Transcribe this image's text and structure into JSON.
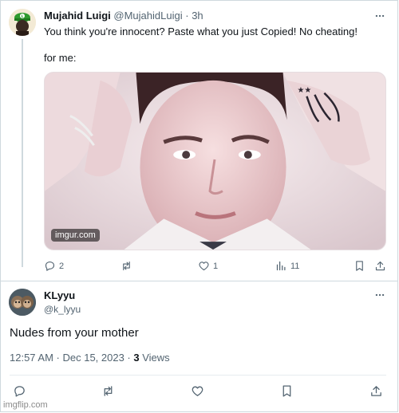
{
  "tweet": {
    "author_name": "Mujahid Luigi",
    "author_handle": "@MujahidLuigi",
    "separator": "·",
    "time": "3h",
    "text_line1": "You think you're innocent? Paste what you just Copied! No cheating!",
    "text_line2": "for me:",
    "image_caption": "imgur.com",
    "actions": {
      "replies": "2",
      "reposts": "",
      "likes": "1",
      "views": "11"
    },
    "icons": [
      "reply-icon",
      "repost-icon",
      "like-icon",
      "views-icon",
      "bookmark-icon",
      "share-icon",
      "more-icon"
    ]
  },
  "reply": {
    "author_name": "KLyyu",
    "author_handle": "@k_lyyu",
    "text": "Nudes from your mother",
    "timestamp": "12:57 AM · Dec 15, 2023 · ",
    "views_count": "3",
    "views_label": " Views"
  },
  "watermark": "imgflip.com",
  "colors": {
    "text": "#0f1419",
    "secondary": "#536471",
    "border": "#cfd9de",
    "luigi_green": "#2e8b2e"
  }
}
